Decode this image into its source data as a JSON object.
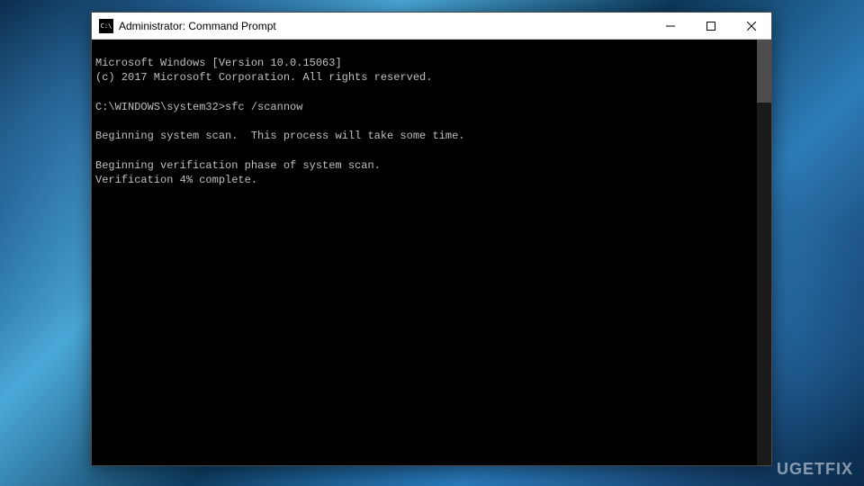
{
  "window": {
    "title": "Administrator: Command Prompt"
  },
  "console": {
    "line1": "Microsoft Windows [Version 10.0.15063]",
    "line2": "(c) 2017 Microsoft Corporation. All rights reserved.",
    "blank1": "",
    "prompt_line": "C:\\WINDOWS\\system32>sfc /scannow",
    "blank2": "",
    "line3": "Beginning system scan.  This process will take some time.",
    "blank3": "",
    "line4": "Beginning verification phase of system scan.",
    "line5": "Verification 4% complete."
  },
  "watermark": {
    "text": "UGETFIX"
  }
}
